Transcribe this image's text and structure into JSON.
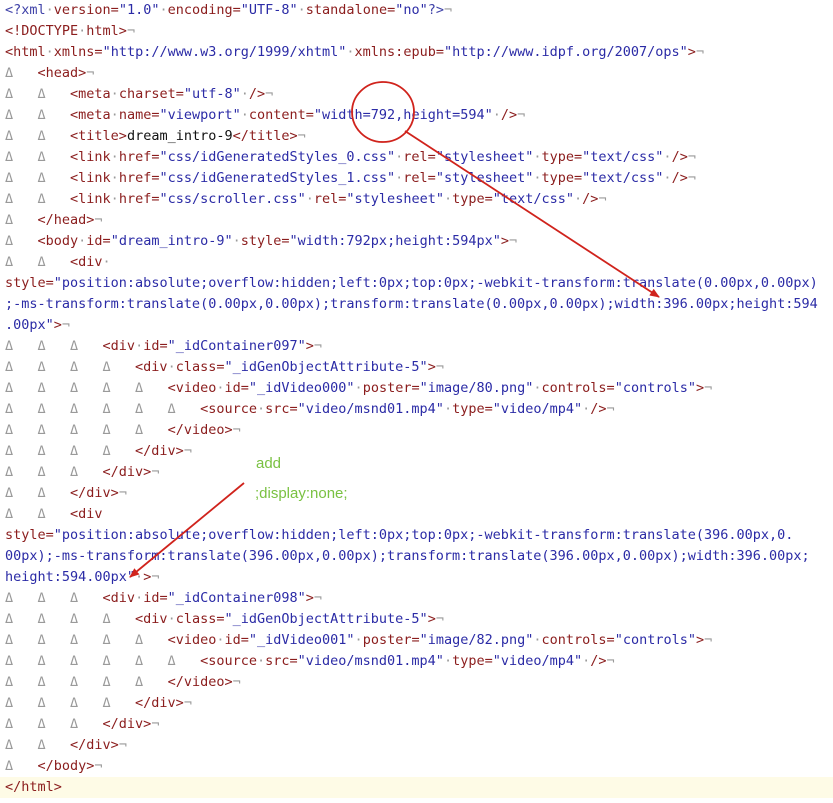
{
  "editor": {
    "lines": [
      {
        "segs": [
          [
            "t-decl",
            "<?xml"
          ],
          [
            "t-ws",
            "·"
          ],
          [
            "t-attr",
            "version="
          ],
          [
            "t-val",
            "\"1.0\""
          ],
          [
            "t-ws",
            "·"
          ],
          [
            "t-attr",
            "encoding="
          ],
          [
            "t-val",
            "\"UTF-8\""
          ],
          [
            "t-ws",
            "·"
          ],
          [
            "t-attr",
            "standalone="
          ],
          [
            "t-val",
            "\"no\""
          ],
          [
            "t-decl",
            "?>"
          ],
          [
            "t-ws",
            "¬"
          ]
        ]
      },
      {
        "segs": [
          [
            "t-tag",
            "<!DOCTYPE"
          ],
          [
            "t-ws",
            "·"
          ],
          [
            "t-tag",
            "html>"
          ],
          [
            "t-ws",
            "¬"
          ]
        ]
      },
      {
        "segs": [
          [
            "t-tag",
            "<html"
          ],
          [
            "t-ws",
            "·"
          ],
          [
            "t-attr",
            "xmlns="
          ],
          [
            "t-val",
            "\"http://www.w3.org/1999/xhtml\""
          ],
          [
            "t-ws",
            "·"
          ],
          [
            "t-attr",
            "xmlns:epub="
          ],
          [
            "t-val",
            "\"http://www.idpf.org/2007/ops\""
          ],
          [
            "t-tag",
            ">"
          ],
          [
            "t-ws",
            "¬"
          ]
        ]
      },
      {
        "segs": [
          [
            "t-ws",
            "Δ   "
          ],
          [
            "t-tag",
            "<head>"
          ],
          [
            "t-ws",
            "¬"
          ]
        ]
      },
      {
        "segs": [
          [
            "t-ws",
            "Δ   Δ   "
          ],
          [
            "t-tag",
            "<meta"
          ],
          [
            "t-ws",
            "·"
          ],
          [
            "t-attr",
            "charset="
          ],
          [
            "t-val",
            "\"utf-8\""
          ],
          [
            "t-ws",
            "·"
          ],
          [
            "t-tag",
            "/>"
          ],
          [
            "t-ws",
            "¬"
          ]
        ]
      },
      {
        "segs": [
          [
            "t-ws",
            "Δ   Δ   "
          ],
          [
            "t-tag",
            "<meta"
          ],
          [
            "t-ws",
            "·"
          ],
          [
            "t-attr",
            "name="
          ],
          [
            "t-val",
            "\"viewport\""
          ],
          [
            "t-ws",
            "·"
          ],
          [
            "t-attr",
            "content="
          ],
          [
            "t-val",
            "\"width=792,height=594\""
          ],
          [
            "t-ws",
            "·"
          ],
          [
            "t-tag",
            "/>"
          ],
          [
            "t-ws",
            "¬"
          ]
        ]
      },
      {
        "segs": [
          [
            "t-ws",
            "Δ   Δ   "
          ],
          [
            "t-tag",
            "<title>"
          ],
          [
            "t-text",
            "dream_intro-9"
          ],
          [
            "t-tag",
            "</title>"
          ],
          [
            "t-ws",
            "¬"
          ]
        ]
      },
      {
        "segs": [
          [
            "t-ws",
            "Δ   Δ   "
          ],
          [
            "t-tag",
            "<link"
          ],
          [
            "t-ws",
            "·"
          ],
          [
            "t-attr",
            "href="
          ],
          [
            "t-val",
            "\"css/idGeneratedStyles_0.css\""
          ],
          [
            "t-ws",
            "·"
          ],
          [
            "t-attr",
            "rel="
          ],
          [
            "t-val",
            "\"stylesheet\""
          ],
          [
            "t-ws",
            "·"
          ],
          [
            "t-attr",
            "type="
          ],
          [
            "t-val",
            "\"text/css\""
          ],
          [
            "t-ws",
            "·"
          ],
          [
            "t-tag",
            "/>"
          ],
          [
            "t-ws",
            "¬"
          ]
        ]
      },
      {
        "segs": [
          [
            "t-ws",
            "Δ   Δ   "
          ],
          [
            "t-tag",
            "<link"
          ],
          [
            "t-ws",
            "·"
          ],
          [
            "t-attr",
            "href="
          ],
          [
            "t-val",
            "\"css/idGeneratedStyles_1.css\""
          ],
          [
            "t-ws",
            "·"
          ],
          [
            "t-attr",
            "rel="
          ],
          [
            "t-val",
            "\"stylesheet\""
          ],
          [
            "t-ws",
            "·"
          ],
          [
            "t-attr",
            "type="
          ],
          [
            "t-val",
            "\"text/css\""
          ],
          [
            "t-ws",
            "·"
          ],
          [
            "t-tag",
            "/>"
          ],
          [
            "t-ws",
            "¬"
          ]
        ]
      },
      {
        "segs": [
          [
            "t-ws",
            "Δ   Δ   "
          ],
          [
            "t-tag",
            "<link"
          ],
          [
            "t-ws",
            "·"
          ],
          [
            "t-attr",
            "href="
          ],
          [
            "t-val",
            "\"css/scroller.css\""
          ],
          [
            "t-ws",
            "·"
          ],
          [
            "t-attr",
            "rel="
          ],
          [
            "t-val",
            "\"stylesheet\""
          ],
          [
            "t-ws",
            "·"
          ],
          [
            "t-attr",
            "type="
          ],
          [
            "t-val",
            "\"text/css\""
          ],
          [
            "t-ws",
            "·"
          ],
          [
            "t-tag",
            "/>"
          ],
          [
            "t-ws",
            "¬"
          ]
        ]
      },
      {
        "segs": [
          [
            "t-ws",
            "Δ   "
          ],
          [
            "t-tag",
            "</head>"
          ],
          [
            "t-ws",
            "¬"
          ]
        ]
      },
      {
        "segs": [
          [
            "t-ws",
            "Δ   "
          ],
          [
            "t-tag",
            "<body"
          ],
          [
            "t-ws",
            "·"
          ],
          [
            "t-attr",
            "id="
          ],
          [
            "t-val",
            "\"dream_intro-9\""
          ],
          [
            "t-ws",
            "·"
          ],
          [
            "t-attr",
            "style="
          ],
          [
            "t-val",
            "\"width:792px;height:594px\""
          ],
          [
            "t-tag",
            ">"
          ],
          [
            "t-ws",
            "¬"
          ]
        ]
      },
      {
        "segs": [
          [
            "t-ws",
            "Δ   Δ   "
          ],
          [
            "t-tag",
            "<div"
          ],
          [
            "t-ws",
            "·"
          ]
        ]
      },
      {
        "segs": [
          [
            "t-attr",
            "style="
          ],
          [
            "t-val",
            "\"position:absolute;overflow:hidden;left:0px;top:0px;-webkit-transform:translate(0.00px,0.00px)"
          ]
        ]
      },
      {
        "segs": [
          [
            "t-val",
            ";-ms-transform:translate(0.00px,0.00px);transform:translate(0.00px,0.00px);width:396.00px;height:594"
          ]
        ]
      },
      {
        "segs": [
          [
            "t-val",
            ".00px\""
          ],
          [
            "t-tag",
            ">"
          ],
          [
            "t-ws",
            "¬"
          ]
        ]
      },
      {
        "segs": [
          [
            "t-ws",
            "Δ   Δ   Δ   "
          ],
          [
            "t-tag",
            "<div"
          ],
          [
            "t-ws",
            "·"
          ],
          [
            "t-attr",
            "id="
          ],
          [
            "t-val",
            "\"_idContainer097\""
          ],
          [
            "t-tag",
            ">"
          ],
          [
            "t-ws",
            "¬"
          ]
        ]
      },
      {
        "segs": [
          [
            "t-ws",
            "Δ   Δ   Δ   Δ   "
          ],
          [
            "t-tag",
            "<div"
          ],
          [
            "t-ws",
            "·"
          ],
          [
            "t-attr",
            "class="
          ],
          [
            "t-val",
            "\"_idGenObjectAttribute-5\""
          ],
          [
            "t-tag",
            ">"
          ],
          [
            "t-ws",
            "¬"
          ]
        ]
      },
      {
        "segs": [
          [
            "t-ws",
            "Δ   Δ   Δ   Δ   Δ   "
          ],
          [
            "t-tag",
            "<video"
          ],
          [
            "t-ws",
            "·"
          ],
          [
            "t-attr",
            "id="
          ],
          [
            "t-val",
            "\"_idVideo000\""
          ],
          [
            "t-ws",
            "·"
          ],
          [
            "t-attr",
            "poster="
          ],
          [
            "t-val",
            "\"image/80.png\""
          ],
          [
            "t-ws",
            "·"
          ],
          [
            "t-attr",
            "controls="
          ],
          [
            "t-val",
            "\"controls\""
          ],
          [
            "t-tag",
            ">"
          ],
          [
            "t-ws",
            "¬"
          ]
        ]
      },
      {
        "segs": [
          [
            "t-ws",
            "Δ   Δ   Δ   Δ   Δ   Δ   "
          ],
          [
            "t-tag",
            "<source"
          ],
          [
            "t-ws",
            "·"
          ],
          [
            "t-attr",
            "src="
          ],
          [
            "t-val",
            "\"video/msnd01.mp4\""
          ],
          [
            "t-ws",
            "·"
          ],
          [
            "t-attr",
            "type="
          ],
          [
            "t-val",
            "\"video/mp4\""
          ],
          [
            "t-ws",
            "·"
          ],
          [
            "t-tag",
            "/>"
          ],
          [
            "t-ws",
            "¬"
          ]
        ]
      },
      {
        "segs": [
          [
            "t-ws",
            "Δ   Δ   Δ   Δ   Δ   "
          ],
          [
            "t-tag",
            "</video>"
          ],
          [
            "t-ws",
            "¬"
          ]
        ]
      },
      {
        "segs": [
          [
            "t-ws",
            "Δ   Δ   Δ   Δ   "
          ],
          [
            "t-tag",
            "</div>"
          ],
          [
            "t-ws",
            "¬"
          ]
        ]
      },
      {
        "segs": [
          [
            "t-ws",
            "Δ   Δ   Δ   "
          ],
          [
            "t-tag",
            "</div>"
          ],
          [
            "t-ws",
            "¬"
          ]
        ]
      },
      {
        "segs": [
          [
            "t-ws",
            "Δ   Δ   "
          ],
          [
            "t-tag",
            "</div>"
          ],
          [
            "t-ws",
            "¬"
          ]
        ]
      },
      {
        "segs": [
          [
            "t-ws",
            "Δ   Δ   "
          ],
          [
            "t-tag",
            "<div"
          ]
        ]
      },
      {
        "segs": [
          [
            "t-attr",
            "style="
          ],
          [
            "t-val",
            "\"position:absolute;overflow:hidden;left:0px;top:0px;-webkit-transform:translate(396.00px,0."
          ]
        ]
      },
      {
        "segs": [
          [
            "t-val",
            "00px);-ms-transform:translate(396.00px,0.00px);transform:translate(396.00px,0.00px);width:396.00px;"
          ]
        ]
      },
      {
        "segs": [
          [
            "t-val",
            "height:594.00px\""
          ],
          [
            "t-ws",
            "·"
          ],
          [
            "t-tag",
            ">"
          ],
          [
            "t-ws",
            "¬"
          ]
        ]
      },
      {
        "segs": [
          [
            "t-ws",
            "Δ   Δ   Δ   "
          ],
          [
            "t-tag",
            "<div"
          ],
          [
            "t-ws",
            "·"
          ],
          [
            "t-attr",
            "id="
          ],
          [
            "t-val",
            "\"_idContainer098\""
          ],
          [
            "t-tag",
            ">"
          ],
          [
            "t-ws",
            "¬"
          ]
        ]
      },
      {
        "segs": [
          [
            "t-ws",
            "Δ   Δ   Δ   Δ   "
          ],
          [
            "t-tag",
            "<div"
          ],
          [
            "t-ws",
            "·"
          ],
          [
            "t-attr",
            "class="
          ],
          [
            "t-val",
            "\"_idGenObjectAttribute-5\""
          ],
          [
            "t-tag",
            ">"
          ],
          [
            "t-ws",
            "¬"
          ]
        ]
      },
      {
        "segs": [
          [
            "t-ws",
            "Δ   Δ   Δ   Δ   Δ   "
          ],
          [
            "t-tag",
            "<video"
          ],
          [
            "t-ws",
            "·"
          ],
          [
            "t-attr",
            "id="
          ],
          [
            "t-val",
            "\"_idVideo001\""
          ],
          [
            "t-ws",
            "·"
          ],
          [
            "t-attr",
            "poster="
          ],
          [
            "t-val",
            "\"image/82.png\""
          ],
          [
            "t-ws",
            "·"
          ],
          [
            "t-attr",
            "controls="
          ],
          [
            "t-val",
            "\"controls\""
          ],
          [
            "t-tag",
            ">"
          ],
          [
            "t-ws",
            "¬"
          ]
        ]
      },
      {
        "segs": [
          [
            "t-ws",
            "Δ   Δ   Δ   Δ   Δ   Δ   "
          ],
          [
            "t-tag",
            "<source"
          ],
          [
            "t-ws",
            "·"
          ],
          [
            "t-attr",
            "src="
          ],
          [
            "t-val",
            "\"video/msnd01.mp4\""
          ],
          [
            "t-ws",
            "·"
          ],
          [
            "t-attr",
            "type="
          ],
          [
            "t-val",
            "\"video/mp4\""
          ],
          [
            "t-ws",
            "·"
          ],
          [
            "t-tag",
            "/>"
          ],
          [
            "t-ws",
            "¬"
          ]
        ]
      },
      {
        "segs": [
          [
            "t-ws",
            "Δ   Δ   Δ   Δ   Δ   "
          ],
          [
            "t-tag",
            "</video>"
          ],
          [
            "t-ws",
            "¬"
          ]
        ]
      },
      {
        "segs": [
          [
            "t-ws",
            "Δ   Δ   Δ   Δ   "
          ],
          [
            "t-tag",
            "</div>"
          ],
          [
            "t-ws",
            "¬"
          ]
        ]
      },
      {
        "segs": [
          [
            "t-ws",
            "Δ   Δ   Δ   "
          ],
          [
            "t-tag",
            "</div>"
          ],
          [
            "t-ws",
            "¬"
          ]
        ]
      },
      {
        "segs": [
          [
            "t-ws",
            "Δ   Δ   "
          ],
          [
            "t-tag",
            "</div>"
          ],
          [
            "t-ws",
            "¬"
          ]
        ]
      },
      {
        "segs": [
          [
            "t-ws",
            "Δ   "
          ],
          [
            "t-tag",
            "</body>"
          ],
          [
            "t-ws",
            "¬"
          ]
        ]
      },
      {
        "segs": [
          [
            "t-tag",
            "</html>"
          ]
        ],
        "current": true
      }
    ]
  },
  "annotations": {
    "line1": "add",
    "line2": ";display:none;",
    "text_color": "#7ac142",
    "marker_color": "#d0231c"
  }
}
